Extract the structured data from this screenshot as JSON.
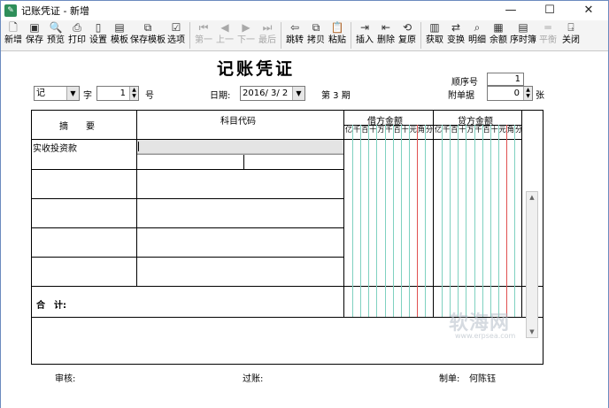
{
  "window": {
    "title": "记账凭证 - 新增",
    "controls": [
      "—",
      "☐",
      "✕"
    ]
  },
  "toolbar": {
    "buttons": [
      {
        "label": "新增",
        "icon": "new-file-icon",
        "glyph": "🗋"
      },
      {
        "label": "保存",
        "icon": "save-icon",
        "glyph": "▣"
      },
      {
        "label": "预览",
        "icon": "preview-icon",
        "glyph": "🔍"
      },
      {
        "label": "打印",
        "icon": "print-icon",
        "glyph": "⎙"
      },
      {
        "label": "设置",
        "icon": "settings-icon",
        "glyph": "▯"
      },
      {
        "label": "模板",
        "icon": "template-icon",
        "glyph": "▤"
      },
      {
        "label": "保存模板",
        "icon": "save-template-icon",
        "glyph": "⧉"
      },
      {
        "label": "选项",
        "icon": "options-icon",
        "glyph": "☑"
      },
      {
        "label": "第一",
        "icon": "first-icon",
        "glyph": "⏮"
      },
      {
        "label": "上一",
        "icon": "prev-icon",
        "glyph": "◀"
      },
      {
        "label": "下一",
        "icon": "next-icon",
        "glyph": "▶"
      },
      {
        "label": "最后",
        "icon": "last-icon",
        "glyph": "⏭"
      },
      {
        "label": "跳转",
        "icon": "jump-icon",
        "glyph": "⇦"
      },
      {
        "label": "拷贝",
        "icon": "copy-icon",
        "glyph": "⧉"
      },
      {
        "label": "粘贴",
        "icon": "paste-icon",
        "glyph": "📋"
      },
      {
        "label": "插入",
        "icon": "insert-icon",
        "glyph": "⇥"
      },
      {
        "label": "删除",
        "icon": "delete-icon",
        "glyph": "⇤"
      },
      {
        "label": "复原",
        "icon": "restore-icon",
        "glyph": "⟲"
      },
      {
        "label": "获取",
        "icon": "fetch-icon",
        "glyph": "▥"
      },
      {
        "label": "变换",
        "icon": "transform-icon",
        "glyph": "⇄"
      },
      {
        "label": "明细",
        "icon": "detail-icon",
        "glyph": "⌕"
      },
      {
        "label": "余额",
        "icon": "balance-icon",
        "glyph": "▦"
      },
      {
        "label": "序时簿",
        "icon": "journal-icon",
        "glyph": "▤"
      },
      {
        "label": "平衡",
        "icon": "balance-check-icon",
        "glyph": "═"
      },
      {
        "label": "关闭",
        "icon": "close-door-icon",
        "glyph": "⍈"
      }
    ]
  },
  "voucher": {
    "heading": "记账凭证",
    "type_value": "记",
    "zi_label": "字",
    "number_value": "1",
    "hao_label": "号",
    "date_label": "日期:",
    "date_value": "2016/ 3/ 2",
    "period_text": "第 3 期",
    "seq_label": "顺序号",
    "seq_value": "1",
    "attach_label": "附单据",
    "attach_value": "0",
    "attach_unit": "张"
  },
  "table": {
    "col_summary": "摘　　要",
    "col_account": "科目代码",
    "col_debit": "借方金额",
    "col_credit": "贷方金额",
    "digits": [
      "亿",
      "千",
      "百",
      "十",
      "万",
      "千",
      "百",
      "十",
      "元",
      "角",
      "分"
    ],
    "row1_summary": "实收投资款",
    "total_label": "合　计:"
  },
  "footer": {
    "audit_label": "审核:",
    "post_label": "过账:",
    "maker_label": "制单:",
    "maker_value": "何陈钰"
  },
  "watermark": {
    "text": "软海网",
    "url": "www.erpsea.com"
  }
}
